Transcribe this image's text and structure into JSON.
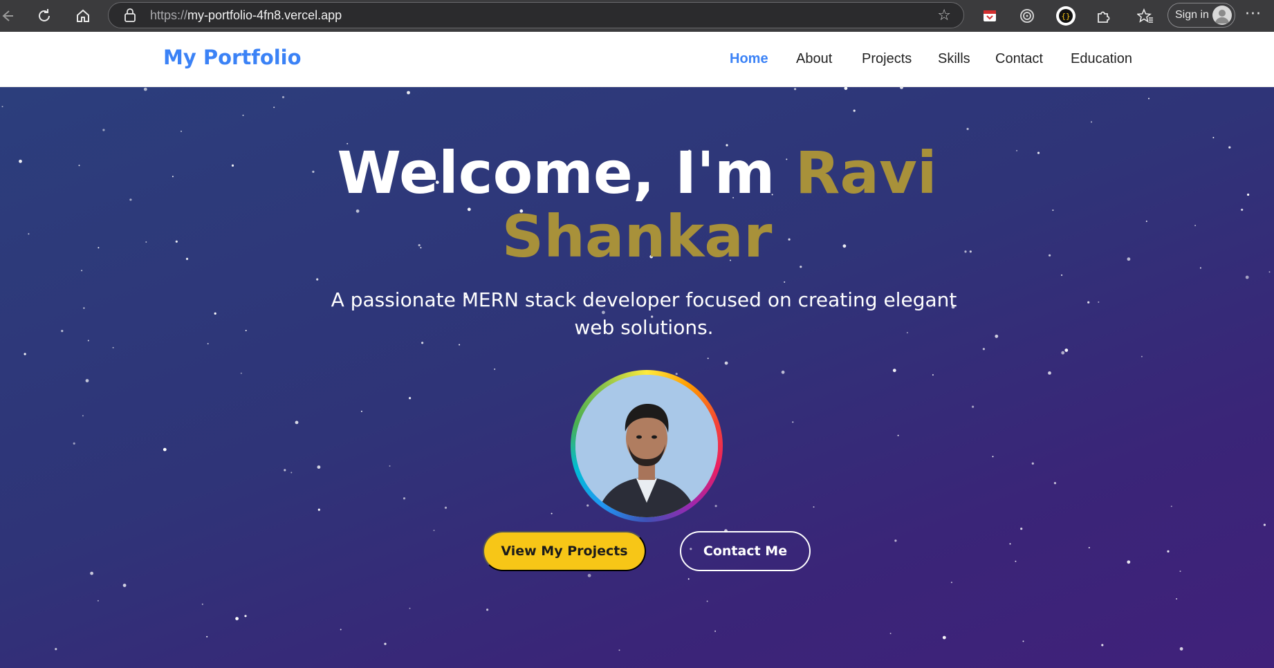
{
  "browser": {
    "url_scheme": "https://",
    "url_host": "my-portfolio-4fn8.vercel.app",
    "signin_label": "Sign in",
    "icons": [
      "back-icon",
      "refresh-icon",
      "home-icon",
      "lock-icon",
      "favorite-star-icon",
      "extension-icon",
      "extensions-puzzle-icon",
      "favorites-icon",
      "profile-avatar-icon",
      "more-icon"
    ]
  },
  "navbar": {
    "brand": "My Portfolio",
    "links": [
      {
        "label": "Home",
        "active": true
      },
      {
        "label": "About",
        "active": false
      },
      {
        "label": "Projects",
        "active": false
      },
      {
        "label": "Skills",
        "active": false
      },
      {
        "label": "Contact",
        "active": false
      },
      {
        "label": "Education",
        "active": false
      }
    ]
  },
  "hero": {
    "greeting": "Welcome, I'm",
    "name_first": "Ravi",
    "name_last": "Shankar",
    "subtitle": "A passionate MERN stack developer focused on creating elegant web solutions.",
    "primary_button": "View My Projects",
    "secondary_button": "Contact Me"
  },
  "colors": {
    "brand": "#3b82f6",
    "name_accent": "#a8913a",
    "primary_button": "#f7c617",
    "hero_bg_start": "#2c3e7c",
    "hero_bg_end": "#40217a"
  }
}
